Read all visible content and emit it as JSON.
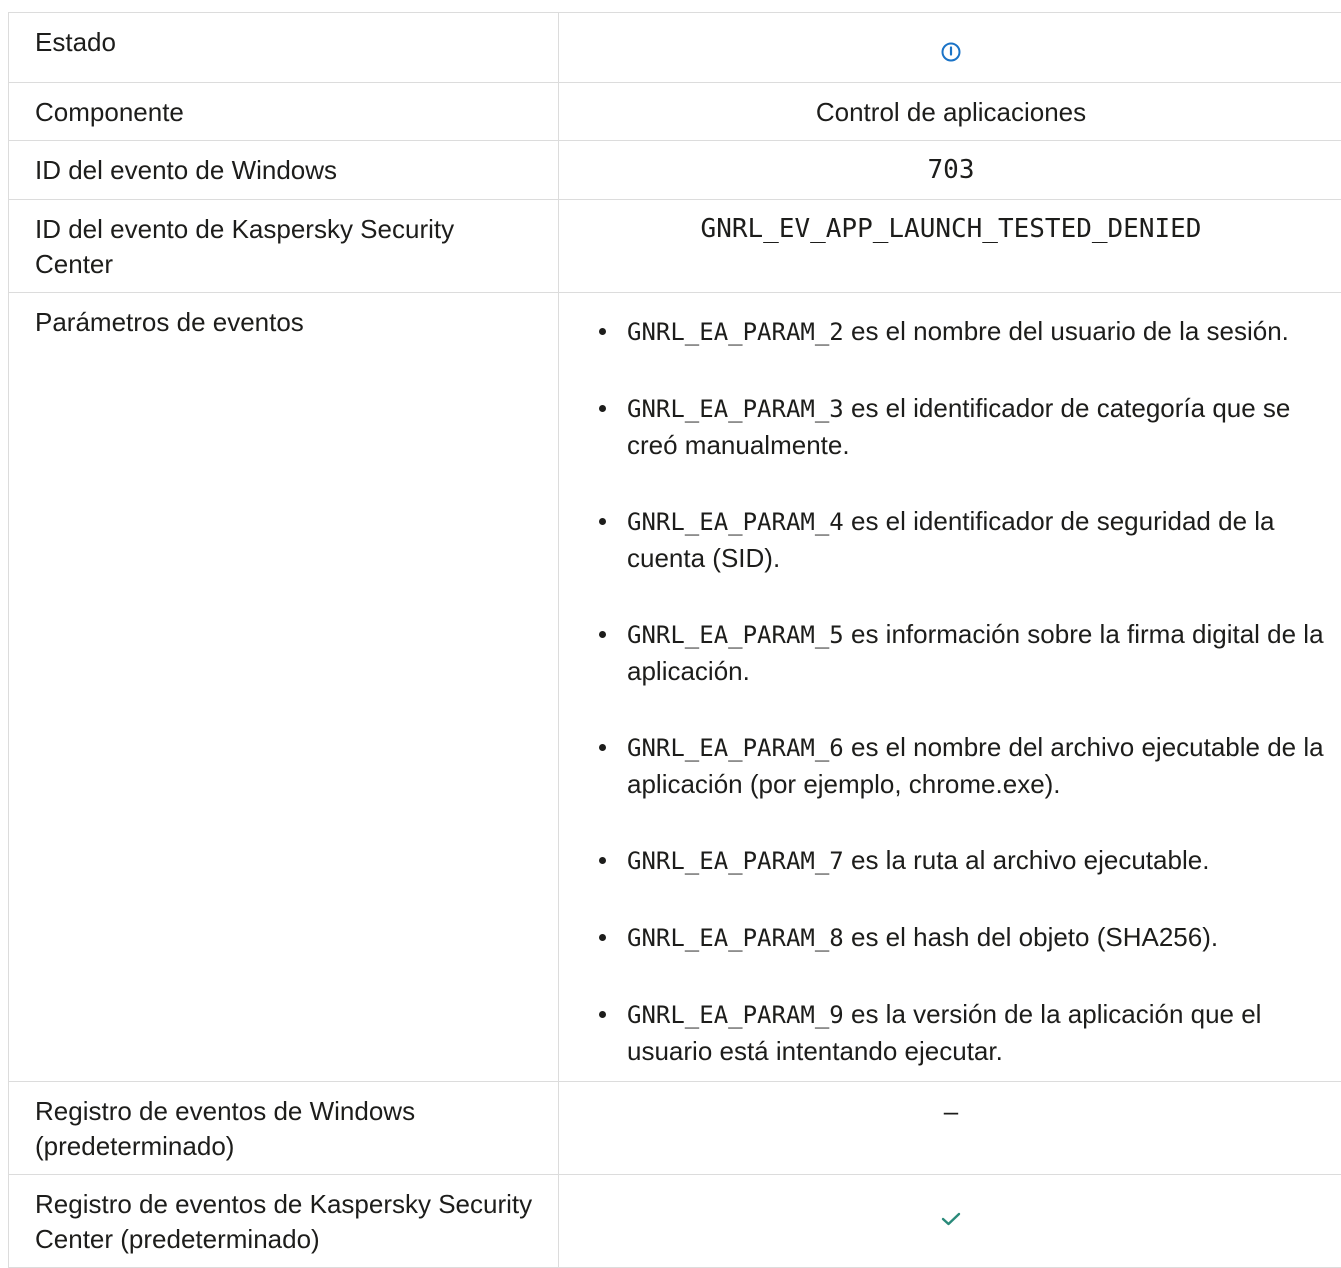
{
  "rows": {
    "estado": {
      "label": "Estado",
      "icon": "info-circle-icon",
      "icon_color": "#1a73c7"
    },
    "componente": {
      "label": "Componente",
      "value": "Control de aplicaciones"
    },
    "windows_id": {
      "label": "ID del evento de Windows",
      "value": "703"
    },
    "ksc_id": {
      "label": "ID del evento de Kaspersky Security Center",
      "value": "GNRL_EV_APP_LAUNCH_TESTED_DENIED"
    },
    "params": {
      "label": "Parámetros de eventos",
      "items": [
        {
          "code": "GNRL_EA_PARAM_2",
          "text": "es el nombre del usuario de la sesión."
        },
        {
          "code": "GNRL_EA_PARAM_3",
          "text": "es el identificador de categoría que se creó manualmente."
        },
        {
          "code": "GNRL_EA_PARAM_4",
          "text": "es el identificador de seguridad de la cuenta (SID)."
        },
        {
          "code": "GNRL_EA_PARAM_5",
          "text": "es información sobre la firma digital de la aplicación."
        },
        {
          "code": "GNRL_EA_PARAM_6",
          "text": "es el nombre del archivo ejecutable de la aplicación (por ejemplo, chrome.exe)."
        },
        {
          "code": "GNRL_EA_PARAM_7",
          "text": "es la ruta al archivo ejecutable."
        },
        {
          "code": "GNRL_EA_PARAM_8",
          "text": "es el hash del objeto (SHA256)."
        },
        {
          "code": "GNRL_EA_PARAM_9",
          "text": "es la versión de la aplicación que el usuario está intentando ejecutar."
        }
      ]
    },
    "windows_log": {
      "label": "Registro de eventos de Windows (predeterminado)",
      "value": "–"
    },
    "ksc_log": {
      "label": "Registro de eventos de Kaspersky Security Center (predeterminado)",
      "icon": "checkmark-icon",
      "icon_color": "#2a8a7a"
    }
  }
}
